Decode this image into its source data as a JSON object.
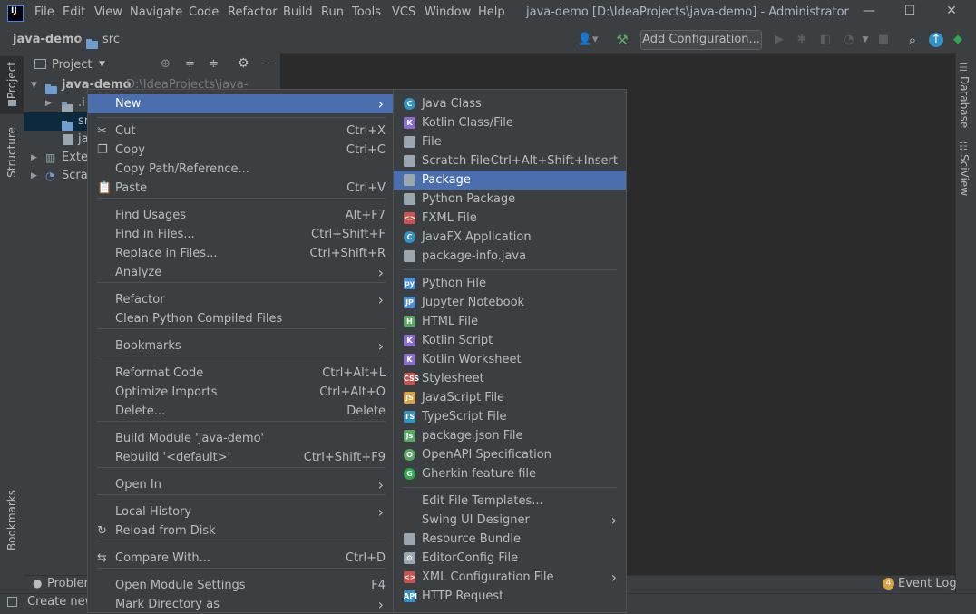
{
  "titlebar": {
    "logo": "IJ",
    "menus": [
      "File",
      "Edit",
      "View",
      "Navigate",
      "Code",
      "Refactor",
      "Build",
      "Run",
      "Tools",
      "VCS",
      "Window",
      "Help"
    ],
    "title": "java-demo [D:\\IdeaProjects\\java-demo] - Administrator",
    "controls": [
      "minimize",
      "maximize",
      "close"
    ]
  },
  "navbar": {
    "breadcrumb": [
      "java-demo",
      "src"
    ],
    "add_config": "Add Configuration..."
  },
  "left_strip": {
    "project": "Project",
    "structure": "Structure",
    "bookmarks": "Bookmarks"
  },
  "right_strip": {
    "database": "Database",
    "sciview": "SciView"
  },
  "project_panel": {
    "title": "Project",
    "rows": [
      {
        "label": "java-demo",
        "path": "D:\\IdeaProjects\\java-demo"
      },
      {
        "label": ".i"
      },
      {
        "label": "sr"
      },
      {
        "label": "ja"
      },
      {
        "label": "Exter"
      },
      {
        "label": "Scrat"
      }
    ]
  },
  "bottom": {
    "problems": "Problem",
    "event_log": "Event Log",
    "event_count": "4",
    "status": "Create new"
  },
  "context_menu": {
    "items": [
      {
        "label": "New",
        "shortcut": "",
        "submenu": true,
        "selected": true
      },
      {
        "label": "Cut",
        "shortcut": "Ctrl+X",
        "icon": "cut-icon"
      },
      {
        "label": "Copy",
        "shortcut": "Ctrl+C",
        "icon": "copy-icon"
      },
      {
        "label": "Copy Path/Reference...",
        "shortcut": ""
      },
      {
        "label": "Paste",
        "shortcut": "Ctrl+V",
        "icon": "paste-icon"
      },
      {
        "label": "Find Usages",
        "shortcut": "Alt+F7"
      },
      {
        "label": "Find in Files...",
        "shortcut": "Ctrl+Shift+F"
      },
      {
        "label": "Replace in Files...",
        "shortcut": "Ctrl+Shift+R"
      },
      {
        "label": "Analyze",
        "shortcut": "",
        "submenu": true
      },
      {
        "label": "Refactor",
        "shortcut": "",
        "submenu": true
      },
      {
        "label": "Clean Python Compiled Files",
        "shortcut": ""
      },
      {
        "label": "Bookmarks",
        "shortcut": "",
        "submenu": true
      },
      {
        "label": "Reformat Code",
        "shortcut": "Ctrl+Alt+L"
      },
      {
        "label": "Optimize Imports",
        "shortcut": "Ctrl+Alt+O"
      },
      {
        "label": "Delete...",
        "shortcut": "Delete"
      },
      {
        "label": "Build Module 'java-demo'",
        "shortcut": ""
      },
      {
        "label": "Rebuild '<default>'",
        "shortcut": "Ctrl+Shift+F9"
      },
      {
        "label": "Open In",
        "shortcut": "",
        "submenu": true
      },
      {
        "label": "Local History",
        "shortcut": "",
        "submenu": true
      },
      {
        "label": "Reload from Disk",
        "shortcut": "",
        "icon": "reload-icon"
      },
      {
        "label": "Compare With...",
        "shortcut": "Ctrl+D",
        "icon": "compare-icon"
      },
      {
        "label": "Open Module Settings",
        "shortcut": "F4"
      },
      {
        "label": "Mark Directory as",
        "shortcut": "",
        "submenu": true
      }
    ]
  },
  "new_submenu": {
    "items": [
      {
        "label": "Java Class",
        "shortcut": "",
        "icon": "java-class-icon",
        "color": "#3592c4",
        "glyph": "C"
      },
      {
        "label": "Kotlin Class/File",
        "shortcut": "",
        "icon": "kotlin-file-icon",
        "color": "#8a6fc9",
        "glyph": "K"
      },
      {
        "label": "File",
        "shortcut": "",
        "icon": "file-icon",
        "color": "#9aa7b0",
        "glyph": ""
      },
      {
        "label": "Scratch File",
        "shortcut": "Ctrl+Alt+Shift+Insert",
        "icon": "scratch-file-icon",
        "color": "#9aa7b0",
        "glyph": ""
      },
      {
        "label": "Package",
        "shortcut": "",
        "icon": "package-icon",
        "color": "#9aa7b0",
        "glyph": "",
        "selected": true
      },
      {
        "label": "Python Package",
        "shortcut": "",
        "icon": "python-package-icon",
        "color": "#9aa7b0",
        "glyph": ""
      },
      {
        "label": "FXML File",
        "shortcut": "",
        "icon": "fxml-file-icon",
        "color": "#c75450",
        "glyph": "<>"
      },
      {
        "label": "JavaFX Application",
        "shortcut": "",
        "icon": "javafx-icon",
        "color": "#3592c4",
        "glyph": "C"
      },
      {
        "label": "package-info.java",
        "shortcut": "",
        "icon": "package-info-icon",
        "color": "#9aa7b0",
        "glyph": ""
      },
      {
        "label": "Python File",
        "shortcut": "",
        "icon": "python-file-icon",
        "color": "#4a8fd4",
        "glyph": "py"
      },
      {
        "label": "Jupyter Notebook",
        "shortcut": "",
        "icon": "jupyter-icon",
        "color": "#4a8fd4",
        "glyph": "JP"
      },
      {
        "label": "HTML File",
        "shortcut": "",
        "icon": "html-file-icon",
        "color": "#59a869",
        "glyph": "H"
      },
      {
        "label": "Kotlin Script",
        "shortcut": "",
        "icon": "kotlin-script-icon",
        "color": "#8a6fc9",
        "glyph": "K"
      },
      {
        "label": "Kotlin Worksheet",
        "shortcut": "",
        "icon": "kotlin-worksheet-icon",
        "color": "#8a6fc9",
        "glyph": "K"
      },
      {
        "label": "Stylesheet",
        "shortcut": "",
        "icon": "css-file-icon",
        "color": "#c75450",
        "glyph": "CSS"
      },
      {
        "label": "JavaScript File",
        "shortcut": "",
        "icon": "js-file-icon",
        "color": "#d9a343",
        "glyph": "JS"
      },
      {
        "label": "TypeScript File",
        "shortcut": "",
        "icon": "ts-file-icon",
        "color": "#3592c4",
        "glyph": "TS"
      },
      {
        "label": "package.json File",
        "shortcut": "",
        "icon": "nodejs-icon",
        "color": "#59a869",
        "glyph": "js"
      },
      {
        "label": "OpenAPI Specification",
        "shortcut": "",
        "icon": "openapi-icon",
        "color": "#59a869",
        "glyph": "O"
      },
      {
        "label": "Gherkin feature file",
        "shortcut": "",
        "icon": "gherkin-icon",
        "color": "#2fa84f",
        "glyph": "G"
      },
      {
        "label": "Edit File Templates...",
        "shortcut": ""
      },
      {
        "label": "Swing UI Designer",
        "shortcut": "",
        "submenu": true
      },
      {
        "label": "Resource Bundle",
        "shortcut": "",
        "icon": "resource-bundle-icon",
        "color": "#9aa7b0",
        "glyph": ""
      },
      {
        "label": "EditorConfig File",
        "shortcut": "",
        "icon": "editorconfig-icon",
        "color": "#9aa7b0",
        "glyph": "⚙"
      },
      {
        "label": "XML Configuration File",
        "shortcut": "",
        "submenu": true,
        "icon": "xml-file-icon",
        "color": "#c75450",
        "glyph": "<>"
      },
      {
        "label": "HTTP Request",
        "shortcut": "",
        "icon": "http-request-icon",
        "color": "#3592c4",
        "glyph": "API"
      }
    ]
  },
  "colors": {
    "selection": "#4b6eaf",
    "menu_bg": "#3c3f41",
    "editor_bg": "#2b2b2b",
    "text": "#bbbbbb"
  }
}
